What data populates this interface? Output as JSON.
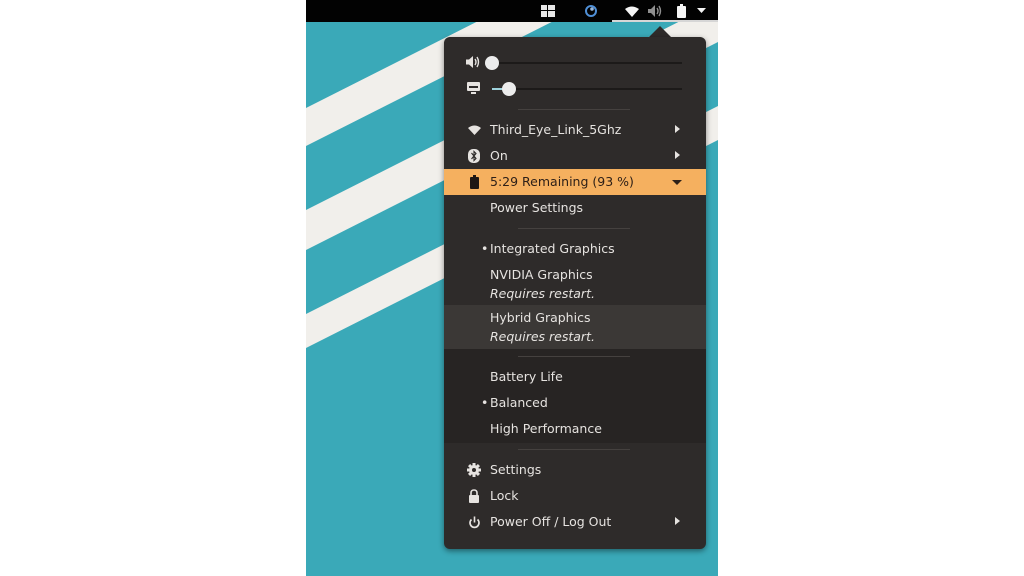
{
  "topbar": {
    "icons": [
      "workspaces-icon",
      "app-icon",
      "wifi-icon",
      "volume-icon",
      "battery-icon",
      "menu-down-icon"
    ]
  },
  "sliders": {
    "volume": {
      "icon": "volume-icon",
      "value_percent": 0
    },
    "brightness": {
      "icon": "display-icon",
      "value_percent": 9
    }
  },
  "network": {
    "icon": "wifi-icon",
    "label": "Third_Eye_Link_5Ghz"
  },
  "bluetooth": {
    "icon": "bluetooth-icon",
    "label": "On"
  },
  "battery": {
    "icon": "battery-icon",
    "label": "5:29 Remaining (93 %)",
    "accent": "#f5b05f"
  },
  "power_settings": {
    "label": "Power Settings"
  },
  "graphics": {
    "options": [
      {
        "label": "Integrated Graphics",
        "selected": true,
        "note": ""
      },
      {
        "label": "NVIDIA Graphics",
        "selected": false,
        "note": "Requires restart."
      },
      {
        "label": "Hybrid Graphics",
        "selected": false,
        "note": "Requires restart."
      }
    ],
    "bullet": "•"
  },
  "power_mode": {
    "options": [
      {
        "label": "Battery Life",
        "selected": false
      },
      {
        "label": "Balanced",
        "selected": true
      },
      {
        "label": "High Performance",
        "selected": false
      }
    ]
  },
  "system": {
    "settings": {
      "icon": "gear-icon",
      "label": "Settings"
    },
    "lock": {
      "icon": "lock-icon",
      "label": "Lock"
    },
    "power": {
      "icon": "power-icon",
      "label": "Power Off / Log Out"
    }
  }
}
